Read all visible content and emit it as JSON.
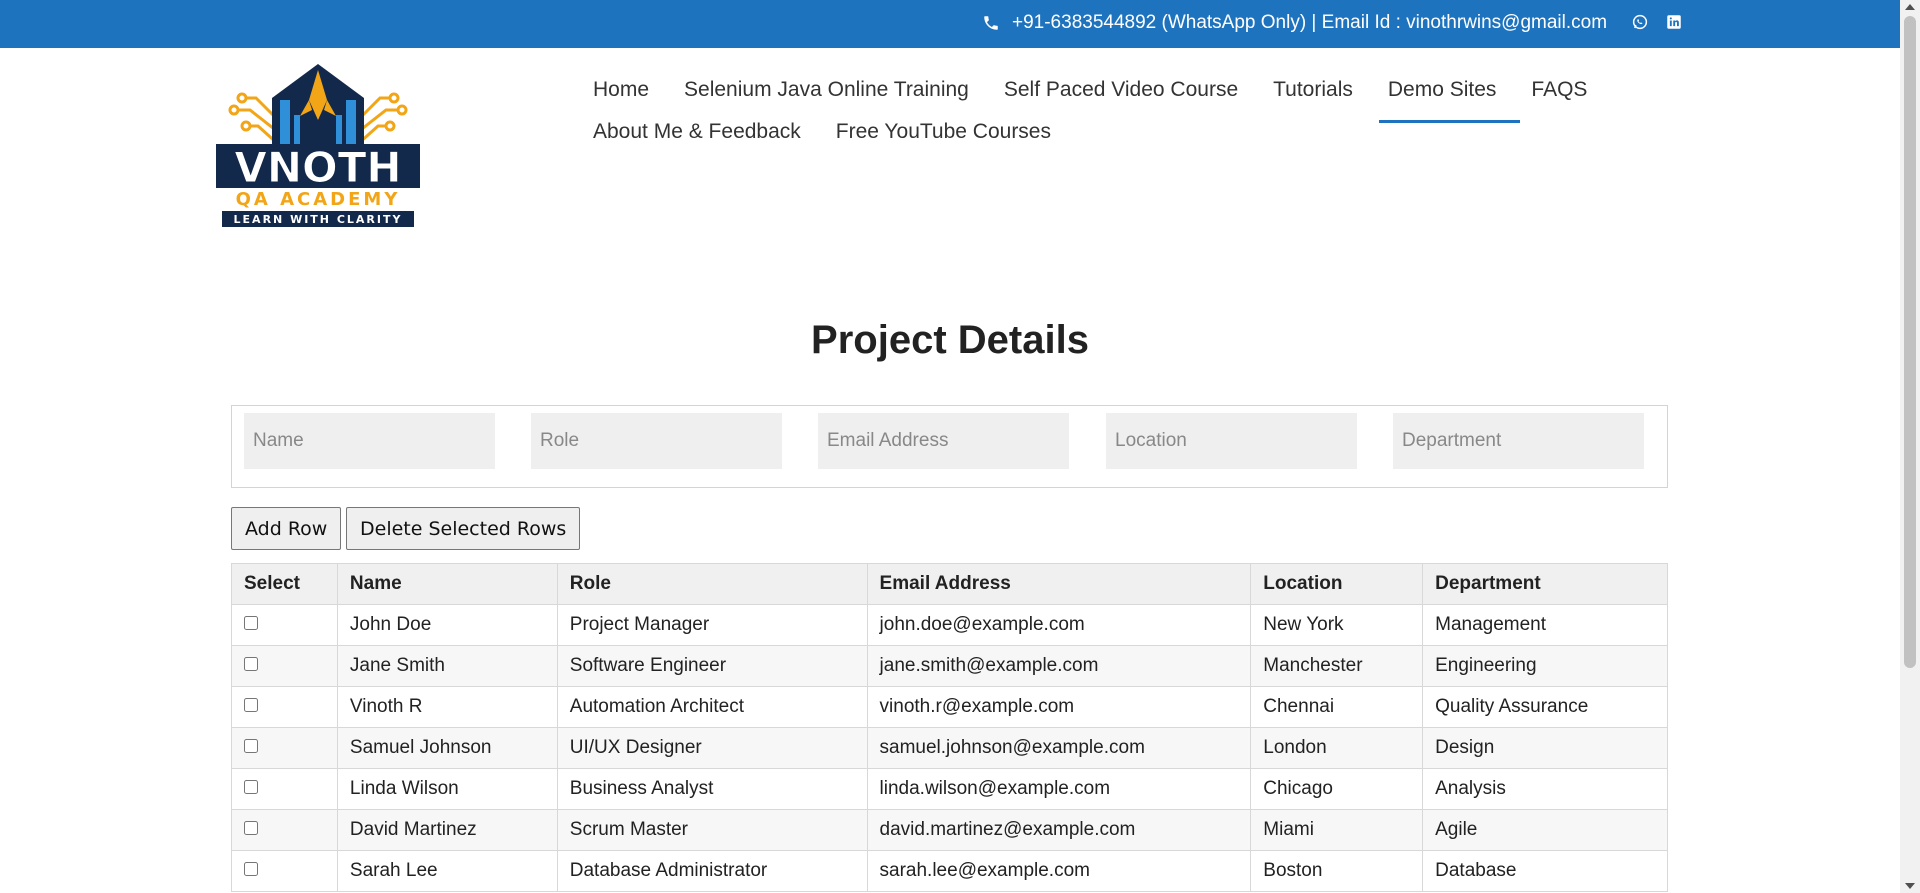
{
  "topbar": {
    "contact_text": "+91-6383544892 (WhatsApp Only) | Email Id : vinothrwins@gmail.com",
    "phone_icon": "phone-icon",
    "social_icons": [
      "whatsapp-icon",
      "linkedin-icon"
    ],
    "background_color": "#1e73be"
  },
  "logo": {
    "text_main": "VNOTH",
    "text_sub": "QA ACADEMY",
    "tagline": "LEARN WITH CLARITY"
  },
  "nav": {
    "items": [
      {
        "label": "Home",
        "active": false
      },
      {
        "label": "Selenium Java Online Training",
        "active": false
      },
      {
        "label": "Self Paced Video Course",
        "active": false
      },
      {
        "label": "Tutorials",
        "active": false
      },
      {
        "label": "Demo Sites",
        "active": true
      },
      {
        "label": "FAQS",
        "active": false
      },
      {
        "label": "About Me & Feedback",
        "active": false
      },
      {
        "label": "Free YouTube Courses",
        "active": false
      }
    ]
  },
  "page_title": "Project Details",
  "form": {
    "name_placeholder": "Name",
    "role_placeholder": "Role",
    "email_placeholder": "Email Address",
    "location_placeholder": "Location",
    "department_placeholder": "Department"
  },
  "buttons": {
    "add_row": "Add Row",
    "delete_selected": "Delete Selected Rows"
  },
  "table": {
    "headers": [
      "Select",
      "Name",
      "Role",
      "Email Address",
      "Location",
      "Department"
    ],
    "rows": [
      {
        "name": "John Doe",
        "role": "Project Manager",
        "email": "john.doe@example.com",
        "location": "New York",
        "department": "Management"
      },
      {
        "name": "Jane Smith",
        "role": "Software Engineer",
        "email": "jane.smith@example.com",
        "location": "Manchester",
        "department": "Engineering"
      },
      {
        "name": "Vinoth R",
        "role": "Automation Architect",
        "email": "vinoth.r@example.com",
        "location": "Chennai",
        "department": "Quality Assurance"
      },
      {
        "name": "Samuel Johnson",
        "role": "UI/UX Designer",
        "email": "samuel.johnson@example.com",
        "location": "London",
        "department": "Design"
      },
      {
        "name": "Linda Wilson",
        "role": "Business Analyst",
        "email": "linda.wilson@example.com",
        "location": "Chicago",
        "department": "Analysis"
      },
      {
        "name": "David Martinez",
        "role": "Scrum Master",
        "email": "david.martinez@example.com",
        "location": "Miami",
        "department": "Agile"
      },
      {
        "name": "Sarah Lee",
        "role": "Database Administrator",
        "email": "sarah.lee@example.com",
        "location": "Boston",
        "department": "Database"
      }
    ]
  }
}
